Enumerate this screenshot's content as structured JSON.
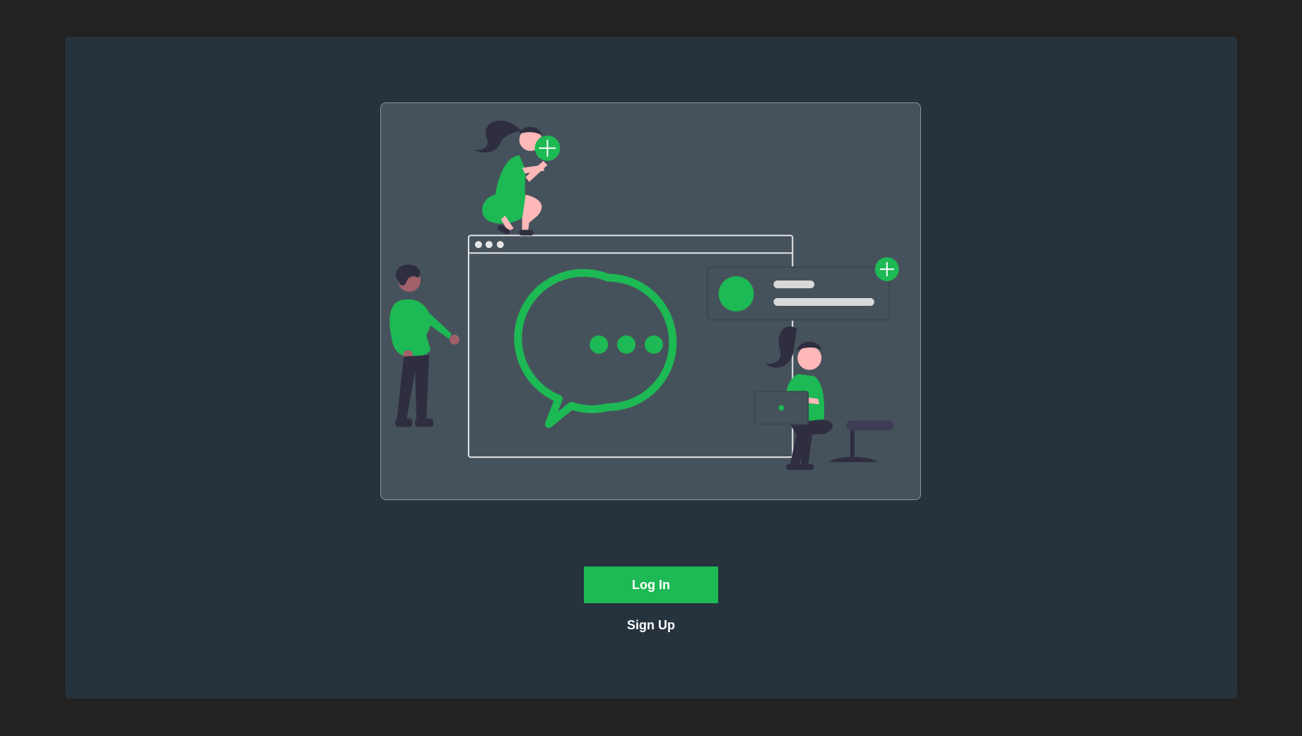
{
  "colors": {
    "page_background": "#232221",
    "card_background": "#26333d",
    "illustration_background": "#46525b",
    "accent": "#1db954",
    "outline": "#e6e6e6",
    "hair": "#2f2e41",
    "skin_light": "#ffb8b8",
    "skin_dark": "#a0616a"
  },
  "illustration": {
    "name": "chat-app-illustration",
    "icons": [
      "chat-bubble-icon",
      "plus-icon",
      "laptop-icon",
      "browser-window-icon"
    ]
  },
  "actions": {
    "login_label": "Log In",
    "signup_label": "Sign Up"
  }
}
